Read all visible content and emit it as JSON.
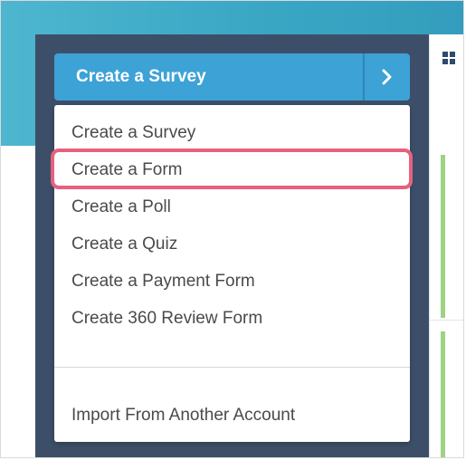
{
  "header": {
    "create_button_label": "Create a Survey",
    "expand_icon": "chevron-right-icon",
    "view_icon": "grid-icon"
  },
  "dropdown": {
    "items": [
      {
        "label": "Create a Survey"
      },
      {
        "label": "Create a Form",
        "highlighted": true
      },
      {
        "label": "Create a Poll"
      },
      {
        "label": "Create a Quiz"
      },
      {
        "label": "Create a Payment Form"
      },
      {
        "label": "Create 360 Review Form"
      }
    ],
    "import_label": "Import From Another Account"
  },
  "colors": {
    "top_band": "#3aa7c5",
    "sidebar": "#3d4f68",
    "create_button": "#3da2d6",
    "highlight": "#e8607f",
    "status_line": "#9fd283"
  }
}
